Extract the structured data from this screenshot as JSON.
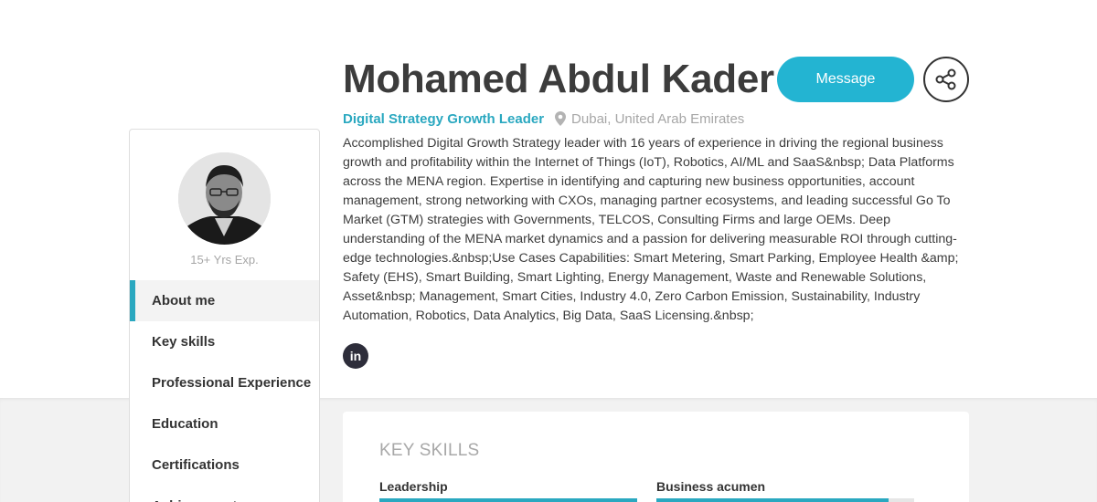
{
  "profile": {
    "name": "Mohamed Abdul Kader S",
    "job_title": "Digital Strategy Growth Leader",
    "location": "Dubai, United Arab Emirates",
    "experience": "15+ Yrs Exp.",
    "bio": "Accomplished Digital Growth Strategy leader with 16 years of experience in driving the regional business growth and profitability within the Internet of Things (IoT), Robotics, AI/ML and SaaS&nbsp; Data Platforms across the MENA region. Expertise in identifying and capturing new business opportunities, account management, strong networking with CXOs, managing partner ecosystems, and leading successful Go To Market (GTM) strategies with Governments, TELCOS, Consulting Firms and large OEMs. Deep understanding of the MENA market dynamics and a passion for delivering measurable ROI through cutting-edge technologies.&nbsp;Use Cases Capabilities: Smart Metering, Smart Parking, Employee Health &amp; Safety (EHS), Smart Building, Smart Lighting, Energy Management, Waste and Renewable Solutions, Asset&nbsp; Management, Smart Cities, Industry 4.0, Zero Carbon Emission, Sustainability, Industry Automation, Robotics, Data Analytics, Big Data, SaaS Licensing.&nbsp;"
  },
  "actions": {
    "message_label": "Message",
    "share_icon": "share-icon",
    "linkedin_label": "in"
  },
  "sidebar": {
    "items": [
      {
        "label": "About me",
        "active": true
      },
      {
        "label": "Key skills",
        "active": false
      },
      {
        "label": "Professional Experience",
        "active": false
      },
      {
        "label": "Education",
        "active": false
      },
      {
        "label": "Certifications",
        "active": false
      },
      {
        "label": "Achievements",
        "active": false
      }
    ]
  },
  "skills": {
    "heading": "KEY SKILLS",
    "items": [
      {
        "label": "Leadership",
        "level": 1.0
      },
      {
        "label": "Business acumen",
        "level": 0.9
      }
    ]
  },
  "colors": {
    "accent": "#2aa8c0",
    "button": "#23b4d2",
    "text": "#3c3c3c",
    "muted": "#a6a6a6"
  }
}
